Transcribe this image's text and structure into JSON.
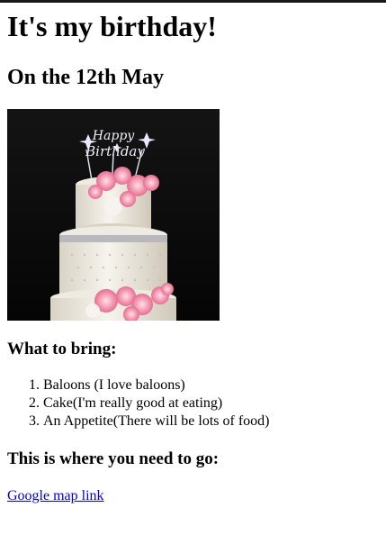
{
  "header": {
    "title": "It's my birthday!",
    "subtitle": "On the 12th May"
  },
  "image": {
    "topper_text_line1": "Happy",
    "topper_text_line2": "Birthday"
  },
  "bring": {
    "heading": "What to bring:",
    "items": [
      "Baloons (I love baloons)",
      "Cake(I'm really good at eating)",
      "An Appetite(There will be lots of food)"
    ]
  },
  "location": {
    "heading": "This is where you need to go:",
    "link_text": "Google map link"
  },
  "colors": {
    "link": "#0000ee",
    "text": "#000000",
    "background": "#ffffff",
    "photo_background": "#0c0c0c",
    "frosting": "#f4f1ea",
    "flowers": "#f2a3b8"
  }
}
